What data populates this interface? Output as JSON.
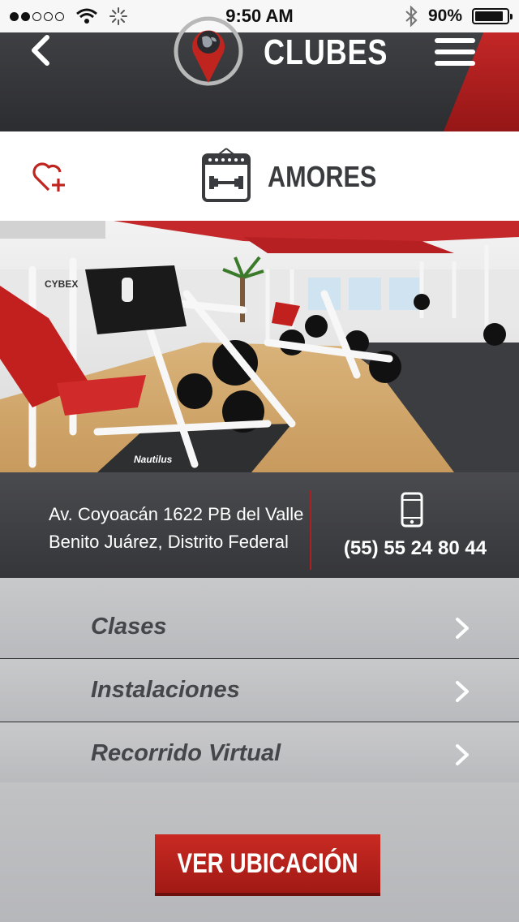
{
  "status": {
    "time": "9:50 AM",
    "battery": "90%",
    "battery_level": 0.9
  },
  "header": {
    "title": "CLUBES",
    "back_icon": "chevron-left-icon",
    "menu_icon": "hamburger-menu-icon",
    "logo_icon": "globe-pin-logo"
  },
  "club": {
    "name": "AMORES",
    "favorite_icon": "heart-plus-icon",
    "club_icon": "calendar-dumbbell-icon"
  },
  "info": {
    "address_line1": "Av. Coyoacán 1622 PB del Valle",
    "address_line2": "Benito Juárez, Distrito Federal",
    "phone": "(55) 55 24 80 44",
    "phone_icon": "mobile-phone-icon"
  },
  "menu": [
    {
      "label": "Clases"
    },
    {
      "label": "Instalaciones"
    },
    {
      "label": "Recorrido Virtual"
    }
  ],
  "cta": {
    "label": "VER UBICACIÓN"
  },
  "photo": {
    "machine_brand_1": "CYBEX",
    "machine_brand_2": "Nautilus"
  },
  "colors": {
    "accent": "#c0241f",
    "header_bg": "#35363a",
    "text_dark": "#45464a"
  }
}
